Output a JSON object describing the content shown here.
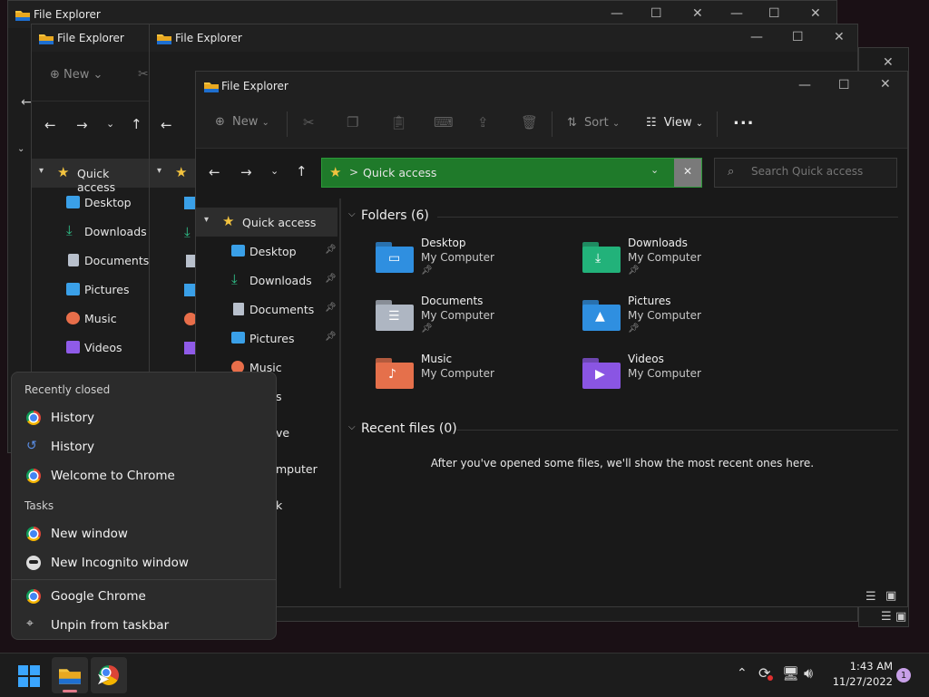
{
  "app_title": "File Explorer",
  "toolbar": {
    "new_label": "New",
    "sort_label": "Sort",
    "view_label": "View",
    "more_label": "..."
  },
  "address": {
    "location": "Quick access",
    "separator": ">"
  },
  "search": {
    "placeholder": "Search Quick access"
  },
  "sidebar": {
    "quick_access": "Quick access",
    "items": [
      {
        "label": "Desktop",
        "icon": "desktop-icon",
        "color": "#3aa0e8"
      },
      {
        "label": "Downloads",
        "icon": "download-icon",
        "color": "#2fc28a"
      },
      {
        "label": "Documents",
        "icon": "document-icon",
        "color": "#b8c0cc"
      },
      {
        "label": "Pictures",
        "icon": "picture-icon",
        "color": "#3aa0e8"
      },
      {
        "label": "Music",
        "icon": "music-icon",
        "color": "#e86e4a"
      },
      {
        "label": "Videos",
        "icon": "video-icon",
        "color": "#8f5be8"
      }
    ],
    "partial_items": [
      "s",
      "ve",
      "mputer",
      "k"
    ]
  },
  "folders_section": {
    "title": "Folders (6)"
  },
  "folders": [
    {
      "name": "Desktop",
      "location": "My Computer",
      "pinned": true,
      "color": "#2f8fe0"
    },
    {
      "name": "Downloads",
      "location": "My Computer",
      "pinned": true,
      "color": "#22b27a"
    },
    {
      "name": "Documents",
      "location": "My Computer",
      "pinned": true,
      "color": "#aeb6c2"
    },
    {
      "name": "Pictures",
      "location": "My Computer",
      "pinned": true,
      "color": "#2f8fe0"
    },
    {
      "name": "Music",
      "location": "My Computer",
      "pinned": false,
      "color": "#e5704b"
    },
    {
      "name": "Videos",
      "location": "My Computer",
      "pinned": false,
      "color": "#8a55e3"
    }
  ],
  "recent_section": {
    "title": "Recent files (0)",
    "empty_message": "After you've opened some files, we'll show the most recent ones here."
  },
  "jump_list": {
    "recently_closed_header": "Recently closed",
    "recently_closed": [
      "History",
      "History",
      "Welcome to Chrome"
    ],
    "tasks_header": "Tasks",
    "tasks": [
      "New window",
      "New Incognito window"
    ],
    "app_name": "Google Chrome",
    "unpin": "Unpin from taskbar"
  },
  "taskbar": {
    "time": "1:43 AM",
    "date": "11/27/2022",
    "notification_count": "1"
  },
  "colors": {
    "address_bar": "#1f7a2a",
    "accent": "#0078d4",
    "folder_yellow": "#f3c33f"
  }
}
